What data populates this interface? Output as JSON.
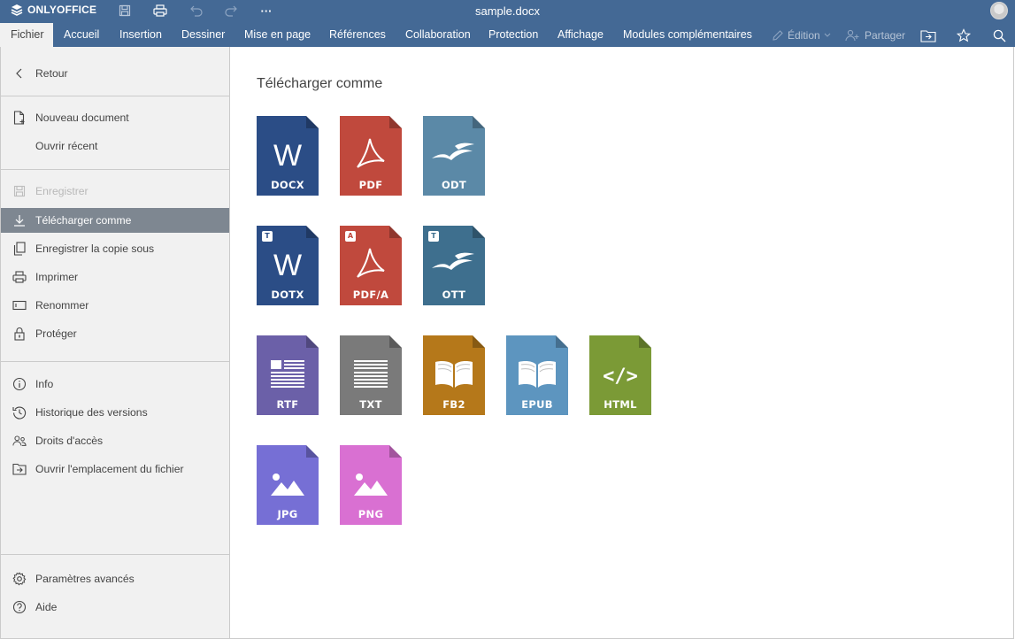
{
  "titlebar": {
    "brand": "ONLYOFFICE",
    "document_title": "sample.docx",
    "more_label": "···"
  },
  "menu": {
    "tabs": [
      {
        "label": "Fichier"
      },
      {
        "label": "Accueil"
      },
      {
        "label": "Insertion"
      },
      {
        "label": "Dessiner"
      },
      {
        "label": "Mise en page"
      },
      {
        "label": "Références"
      },
      {
        "label": "Collaboration"
      },
      {
        "label": "Protection"
      },
      {
        "label": "Affichage"
      },
      {
        "label": "Modules complémentaires"
      }
    ],
    "edit_mode_label": "Édition",
    "share_label": "Partager"
  },
  "sidebar": {
    "back": "Retour",
    "new_document": "Nouveau document",
    "open_recent": "Ouvrir récent",
    "save": "Enregistrer",
    "download_as": "Télécharger comme",
    "save_copy_as": "Enregistrer la copie sous",
    "print": "Imprimer",
    "rename": "Renommer",
    "protect": "Protéger",
    "info": "Info",
    "version_history": "Historique des versions",
    "access_rights": "Droits d'accès",
    "open_location": "Ouvrir l'emplacement du fichier",
    "advanced_settings": "Paramètres avancés",
    "help": "Aide"
  },
  "main": {
    "title": "Télécharger comme",
    "formats": [
      {
        "label": "DOCX",
        "glyph": "W",
        "badge": "",
        "color": "#2b4d86"
      },
      {
        "label": "PDF",
        "glyph": "",
        "badge": "",
        "color": "#c0493d"
      },
      {
        "label": "ODT",
        "glyph": "",
        "badge": "",
        "color": "#5b89a7"
      },
      {
        "label": "DOTX",
        "glyph": "W",
        "badge": "T",
        "color": "#2b4d86"
      },
      {
        "label": "PDF/A",
        "glyph": "",
        "badge": "A",
        "color": "#c0493d"
      },
      {
        "label": "OTT",
        "glyph": "",
        "badge": "T",
        "color": "#3e6f8e"
      },
      {
        "label": "RTF",
        "glyph": "",
        "badge": "",
        "color": "#6b60a8"
      },
      {
        "label": "TXT",
        "glyph": "",
        "badge": "",
        "color": "#7a7a7a"
      },
      {
        "label": "FB2",
        "glyph": "",
        "badge": "",
        "color": "#b5781a"
      },
      {
        "label": "EPUB",
        "glyph": "",
        "badge": "",
        "color": "#5d95bf"
      },
      {
        "label": "HTML",
        "glyph": "</>",
        "badge": "",
        "color": "#7b9a36"
      },
      {
        "label": "JPG",
        "glyph": "",
        "badge": "",
        "color": "#766fd5"
      },
      {
        "label": "PNG",
        "glyph": "",
        "badge": "",
        "color": "#d970d2"
      }
    ]
  },
  "colors": {
    "header_bg": "#446995",
    "sidebar_bg": "#f1f1f1",
    "active_item_bg": "#7e8791"
  }
}
